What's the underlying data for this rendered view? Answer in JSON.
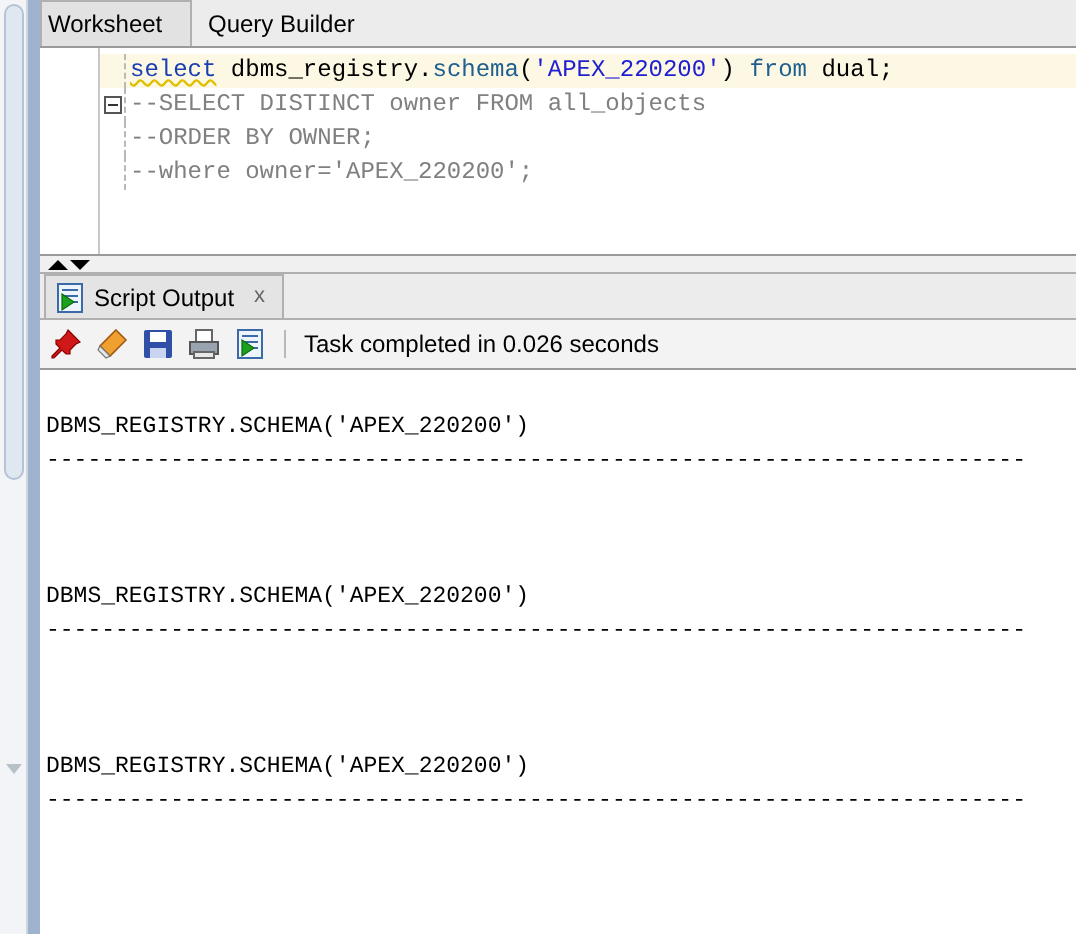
{
  "tabs": [
    {
      "label": "Worksheet",
      "selected": true
    },
    {
      "label": "Query Builder",
      "selected": false
    }
  ],
  "editor": {
    "lines": [
      {
        "current": true,
        "fold_marker": false,
        "tokens": [
          {
            "kind": "keyword",
            "text": "select",
            "flagged": true
          },
          {
            "kind": "plain",
            "text": " dbms_registry.",
            "flagged": false
          },
          {
            "kind": "function",
            "text": "schema",
            "flagged": false
          },
          {
            "kind": "plain",
            "text": "(",
            "flagged": false
          },
          {
            "kind": "string",
            "text": "'APEX_220200'",
            "flagged": false
          },
          {
            "kind": "plain",
            "text": ") ",
            "flagged": false
          },
          {
            "kind": "function",
            "text": "from",
            "flagged": false
          },
          {
            "kind": "plain",
            "text": " dual;",
            "flagged": false
          }
        ]
      },
      {
        "current": false,
        "fold_marker": true,
        "tokens": [
          {
            "kind": "comment",
            "text": "--SELECT DISTINCT owner FROM all_objects",
            "flagged": false
          }
        ]
      },
      {
        "current": false,
        "fold_marker": false,
        "tokens": [
          {
            "kind": "comment",
            "text": "--ORDER BY OWNER;",
            "flagged": false
          }
        ]
      },
      {
        "current": false,
        "fold_marker": false,
        "tokens": [
          {
            "kind": "comment",
            "text": "--where owner='APEX_220200';",
            "flagged": false
          }
        ]
      }
    ]
  },
  "output_panel": {
    "tab": {
      "label": "Script Output",
      "close": "x"
    },
    "status": "Task completed in 0.026 seconds",
    "results": [
      {
        "header": "DBMS_REGISTRY.SCHEMA('APEX_220200')",
        "rule": "-----------------------------------------------------------------------"
      },
      {
        "header": "DBMS_REGISTRY.SCHEMA('APEX_220200')",
        "rule": "-----------------------------------------------------------------------"
      },
      {
        "header": "DBMS_REGISTRY.SCHEMA('APEX_220200')",
        "rule": "-----------------------------------------------------------------------"
      }
    ]
  }
}
